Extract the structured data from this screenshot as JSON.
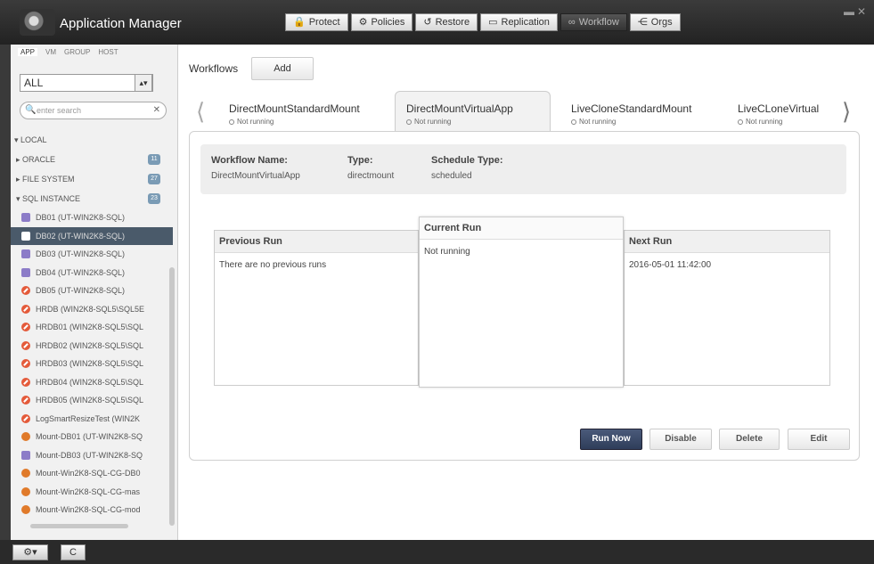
{
  "app": {
    "title": "Application Manager"
  },
  "nav": {
    "tabs": [
      {
        "label": "Protect",
        "icon": "lock-icon"
      },
      {
        "label": "Policies",
        "icon": "gear-icon"
      },
      {
        "label": "Restore",
        "icon": "restore-icon"
      },
      {
        "label": "Replication",
        "icon": "replication-icon"
      },
      {
        "label": "Workflow",
        "icon": "workflow-icon",
        "active": true
      },
      {
        "label": "Orgs",
        "icon": "orgs-icon"
      }
    ]
  },
  "sidebar": {
    "tabs": [
      "APP",
      "VM",
      "GROUP",
      "HOST"
    ],
    "filter": "ALL",
    "search_placeholder": "enter search",
    "local_label": "LOCAL",
    "groups": [
      {
        "label": "ORACLE",
        "count": "11"
      },
      {
        "label": "FILE SYSTEM",
        "count": "27"
      },
      {
        "label": "SQL INSTANCE",
        "count": "23"
      }
    ],
    "items": [
      {
        "label": "DB01 (UT-WIN2K8-SQL)",
        "type": "db"
      },
      {
        "label": "DB02 (UT-WIN2K8-SQL)",
        "type": "db",
        "selected": true
      },
      {
        "label": "DB03 (UT-WIN2K8-SQL)",
        "type": "db"
      },
      {
        "label": "DB04 (UT-WIN2K8-SQL)",
        "type": "db"
      },
      {
        "label": "DB05 (UT-WIN2K8-SQL)",
        "type": "err"
      },
      {
        "label": "HRDB (WIN2K8-SQL5\\SQL5E",
        "type": "err"
      },
      {
        "label": "HRDB01 (WIN2K8-SQL5\\SQL",
        "type": "err"
      },
      {
        "label": "HRDB02 (WIN2K8-SQL5\\SQL",
        "type": "err"
      },
      {
        "label": "HRDB03 (WIN2K8-SQL5\\SQL",
        "type": "err"
      },
      {
        "label": "HRDB04 (WIN2K8-SQL5\\SQL",
        "type": "err"
      },
      {
        "label": "HRDB05 (WIN2K8-SQL5\\SQL",
        "type": "err"
      },
      {
        "label": "LogSmartResizeTest (WIN2K",
        "type": "err"
      },
      {
        "label": "Mount-DB01 (UT-WIN2K8-SQ",
        "type": "warn"
      },
      {
        "label": "Mount-DB03 (UT-WIN2K8-SQ",
        "type": "db"
      },
      {
        "label": "Mount-Win2K8-SQL-CG-DB0",
        "type": "warn"
      },
      {
        "label": "Mount-Win2K8-SQL-CG-mas",
        "type": "warn"
      },
      {
        "label": "Mount-Win2K8-SQL-CG-mod",
        "type": "warn"
      }
    ]
  },
  "bottom": {
    "settings": "⚙▾",
    "refresh": "C"
  },
  "main": {
    "title": "Workflows",
    "add_label": "Add",
    "workflows": [
      {
        "name": "DirectMountStandardMount",
        "status": "Not running"
      },
      {
        "name": "DirectMountVirtualApp",
        "status": "Not running",
        "active": true
      },
      {
        "name": "LiveCloneStandardMount",
        "status": "Not running"
      },
      {
        "name": "LiveCLoneVirtual",
        "status": "Not running"
      }
    ],
    "info": {
      "name_label": "Workflow Name:",
      "name_value": "DirectMountVirtualApp",
      "type_label": "Type:",
      "type_value": "directmount",
      "schedule_label": "Schedule Type:",
      "schedule_value": "scheduled"
    },
    "previous_run": {
      "label": "Previous Run",
      "value": "There are no previous runs"
    },
    "current_run": {
      "label": "Current Run",
      "value": "Not running"
    },
    "next_run": {
      "label": "Next Run",
      "value": "2016-05-01 11:42:00"
    },
    "actions": {
      "run_now": "Run Now",
      "disable": "Disable",
      "delete": "Delete",
      "edit": "Edit"
    }
  }
}
